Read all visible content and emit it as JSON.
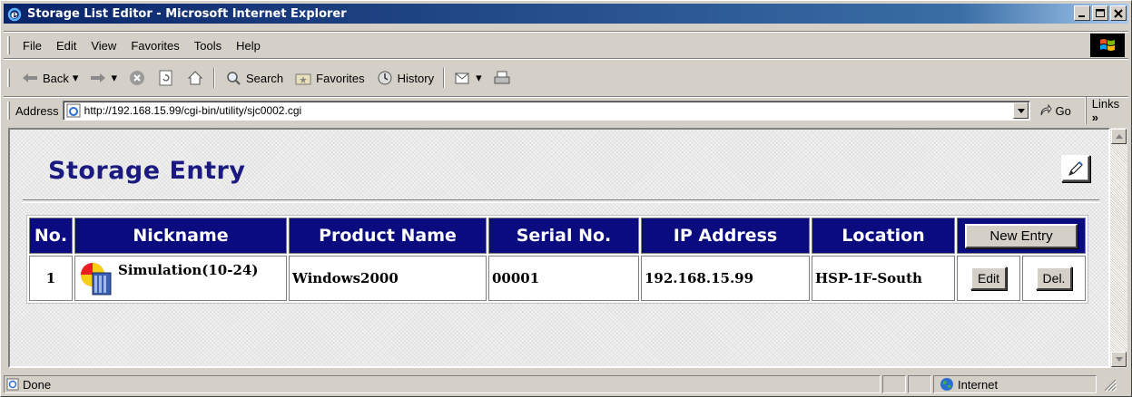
{
  "window": {
    "title": "Storage List Editor - Microsoft Internet Explorer"
  },
  "menu": {
    "items": [
      {
        "label": "File"
      },
      {
        "label": "Edit"
      },
      {
        "label": "View"
      },
      {
        "label": "Favorites"
      },
      {
        "label": "Tools"
      },
      {
        "label": "Help"
      }
    ]
  },
  "toolbar": {
    "back": "Back",
    "search": "Search",
    "favorites": "Favorites",
    "history": "History"
  },
  "address": {
    "label": "Address",
    "url": "http://192.168.15.99/cgi-bin/utility/sjc0002.cgi",
    "go": "Go",
    "links": "Links"
  },
  "page": {
    "title": "Storage Entry",
    "table": {
      "headers": [
        "No.",
        "Nickname",
        "Product Name",
        "Serial No.",
        "IP Address",
        "Location"
      ],
      "new_entry": "New Entry",
      "rows": [
        {
          "no": "1",
          "nickname": "Simulation(10-24)",
          "product": "Windows2000",
          "serial": "00001",
          "ip": "192.168.15.99",
          "location": "HSP-1F-South",
          "edit": "Edit",
          "del": "Del."
        }
      ]
    }
  },
  "status": {
    "text": "Done",
    "zone": "Internet"
  },
  "colors": {
    "titlebar": "#0a246a",
    "header_bg": "#0b0b80",
    "title_text": "#1a1a80"
  }
}
